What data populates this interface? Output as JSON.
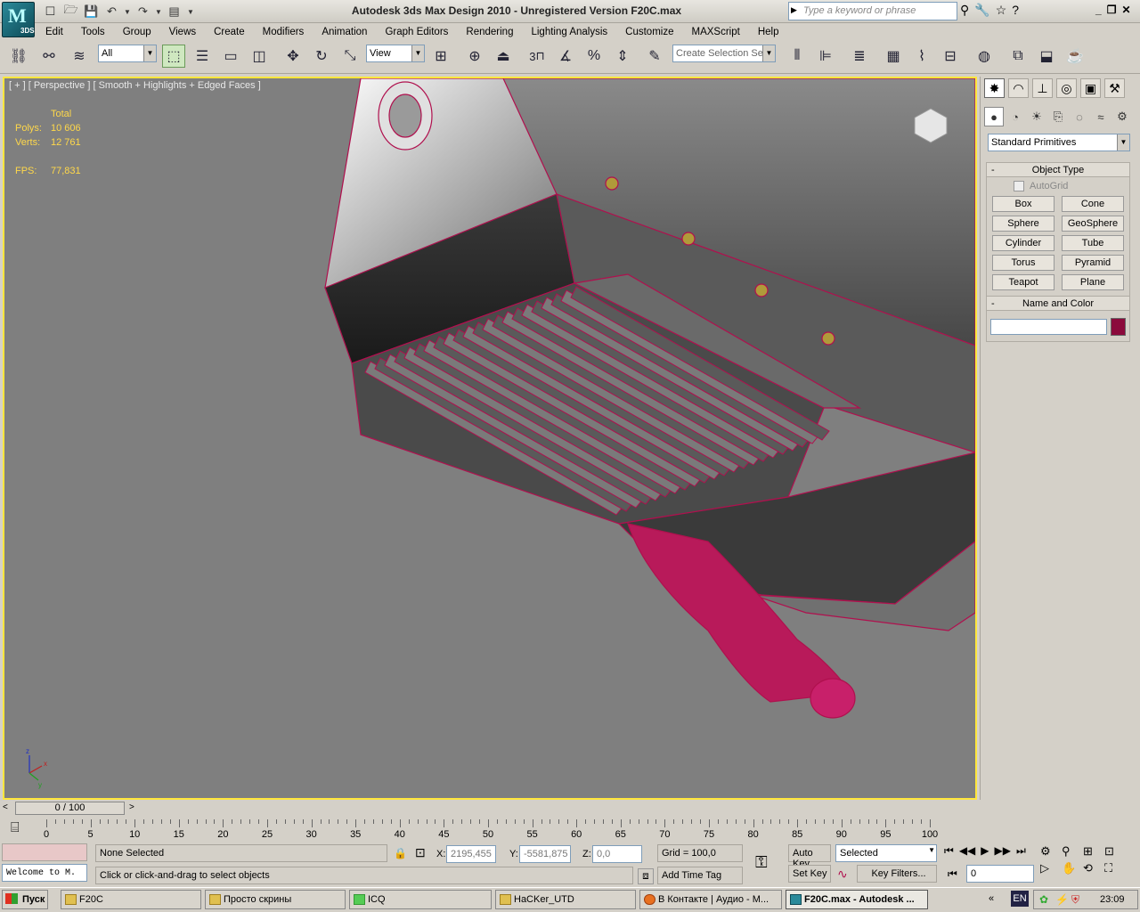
{
  "app": {
    "title": "Autodesk 3ds Max Design 2010  - Unregistered Version    F20C.max",
    "logo_text": "3DS",
    "search_placeholder": "Type a keyword or phrase"
  },
  "menu": [
    "Edit",
    "Tools",
    "Group",
    "Views",
    "Create",
    "Modifiers",
    "Animation",
    "Graph Editors",
    "Rendering",
    "Lighting Analysis",
    "Customize",
    "MAXScript",
    "Help"
  ],
  "toolbar": {
    "filter_value": "All",
    "refcoord_value": "View",
    "selection_set_placeholder": "Create Selection Se",
    "snap_label": "3"
  },
  "viewport": {
    "label": "[ + ] [ Perspective ] [ Smooth + Highlights + Edged Faces ]",
    "stats": {
      "header": "Total",
      "polys_label": "Polys:",
      "polys_value": "10 606",
      "verts_label": "Verts:",
      "verts_value": "12 761",
      "fps_label": "FPS:",
      "fps_value": "77,831"
    },
    "wire_color": "#b0104e",
    "bg_color": "#7f7f7f"
  },
  "command_panel": {
    "primitive_type": "Standard Primitives",
    "object_type_title": "Object Type",
    "autogrid_label": "AutoGrid",
    "buttons": [
      "Box",
      "Cone",
      "Sphere",
      "GeoSphere",
      "Cylinder",
      "Tube",
      "Torus",
      "Pyramid",
      "Teapot",
      "Plane"
    ],
    "name_color_title": "Name and Color",
    "object_color": "#8b0a3c"
  },
  "timeline": {
    "slider_label": "0 / 100",
    "ticks": [
      "0",
      "5",
      "10",
      "15",
      "20",
      "25",
      "30",
      "35",
      "40",
      "45",
      "50",
      "55",
      "60",
      "65",
      "70",
      "75",
      "80",
      "85",
      "90",
      "95",
      "100"
    ]
  },
  "status": {
    "listener_text": "Welcome to M.",
    "selection_text": "None Selected",
    "prompt_text": "Click or click-and-drag to select objects",
    "x_label": "X:",
    "x_value": "2195,455",
    "y_label": "Y:",
    "y_value": "-5581,875",
    "z_label": "Z:",
    "z_value": "0,0",
    "grid_text": "Grid = 100,0",
    "add_time_tag": "Add Time Tag",
    "auto_key": "Auto Key",
    "set_key": "Set Key",
    "selected_value": "Selected",
    "key_filters": "Key Filters...",
    "frame_value": "0"
  },
  "taskbar": {
    "start": "Пуск",
    "tasks": [
      "F20C",
      "Просто скрины",
      "ICQ",
      "HaCKer_UTD",
      "В Контакте | Аудио - M...",
      "F20C.max - Autodesk ..."
    ],
    "lang": "EN",
    "clock": "23:09"
  }
}
